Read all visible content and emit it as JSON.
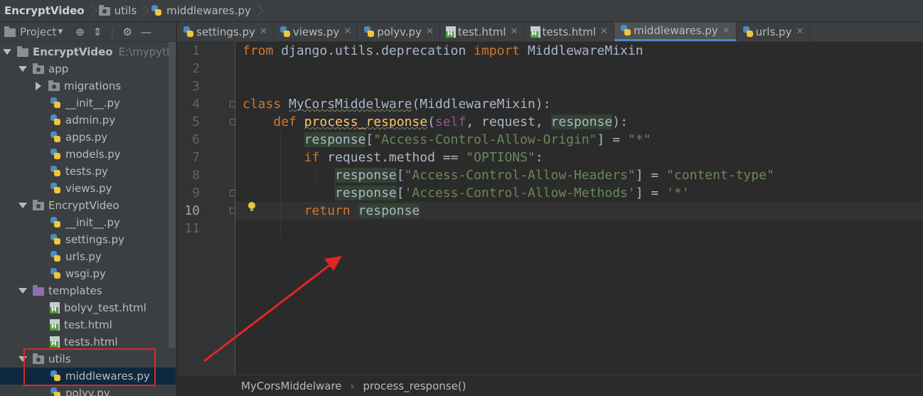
{
  "breadcrumb": [
    "EncryptVideo",
    "utils",
    "middlewares.py"
  ],
  "sidebar": {
    "view_label": "Project",
    "toolbar_icons": [
      "globe-icon",
      "collapse-icon",
      "gear-icon",
      "minimize-icon"
    ],
    "tree": [
      {
        "label": "EncryptVideo",
        "path": "E:\\mypython",
        "kind": "folder",
        "level": 0,
        "expanded": true
      },
      {
        "label": "app",
        "kind": "package",
        "level": 1,
        "expanded": true
      },
      {
        "label": "migrations",
        "kind": "package",
        "level": 2,
        "expanded": false
      },
      {
        "label": "__init__.py",
        "kind": "py",
        "level": 2
      },
      {
        "label": "admin.py",
        "kind": "py",
        "level": 2
      },
      {
        "label": "apps.py",
        "kind": "py",
        "level": 2
      },
      {
        "label": "models.py",
        "kind": "py",
        "level": 2
      },
      {
        "label": "tests.py",
        "kind": "py",
        "level": 2
      },
      {
        "label": "views.py",
        "kind": "py",
        "level": 2
      },
      {
        "label": "EncryptVideo",
        "kind": "package",
        "level": 1,
        "expanded": true
      },
      {
        "label": "__init__.py",
        "kind": "py",
        "level": 2
      },
      {
        "label": "settings.py",
        "kind": "py",
        "level": 2
      },
      {
        "label": "urls.py",
        "kind": "py",
        "level": 2
      },
      {
        "label": "wsgi.py",
        "kind": "py",
        "level": 2
      },
      {
        "label": "templates",
        "kind": "templates",
        "level": 1,
        "expanded": true
      },
      {
        "label": "bolyv_test.html",
        "kind": "html",
        "level": 2
      },
      {
        "label": "test.html",
        "kind": "html",
        "level": 2
      },
      {
        "label": "tests.html",
        "kind": "html",
        "level": 2
      },
      {
        "label": "utils",
        "kind": "package",
        "level": 1,
        "expanded": true
      },
      {
        "label": "middlewares.py",
        "kind": "py",
        "level": 2,
        "selected": true
      },
      {
        "label": "polyv.py",
        "kind": "py",
        "level": 2
      }
    ]
  },
  "tabs": [
    {
      "label": "settings.py",
      "kind": "py"
    },
    {
      "label": "views.py",
      "kind": "py"
    },
    {
      "label": "polyv.py",
      "kind": "py"
    },
    {
      "label": "test.html",
      "kind": "html"
    },
    {
      "label": "tests.html",
      "kind": "html"
    },
    {
      "label": "middlewares.py",
      "kind": "py",
      "active": true
    },
    {
      "label": "urls.py",
      "kind": "py"
    }
  ],
  "editor": {
    "line_numbers": [
      "1",
      "2",
      "3",
      "4",
      "5",
      "6",
      "7",
      "8",
      "9",
      "10",
      "11"
    ],
    "current_line": 10,
    "lines": [
      [
        {
          "t": "from",
          "c": "kw"
        },
        {
          "t": " django.utils.deprecation "
        },
        {
          "t": "import",
          "c": "kw"
        },
        {
          "t": " MiddlewareMixin"
        }
      ],
      [],
      [],
      [
        {
          "t": "class",
          "c": "kw"
        },
        {
          "t": " "
        },
        {
          "t": "MyCorsMiddelware",
          "c": "wavy"
        },
        {
          "t": "(MiddlewareMixin):"
        }
      ],
      [
        {
          "t": "    "
        },
        {
          "t": "def",
          "c": "kw"
        },
        {
          "t": " "
        },
        {
          "t": "process_response",
          "c": "fn wavy"
        },
        {
          "t": "("
        },
        {
          "t": "self",
          "c": "self"
        },
        {
          "t": ", request, "
        },
        {
          "t": "response",
          "c": "hl"
        },
        {
          "t": "):"
        }
      ],
      [
        {
          "t": "        "
        },
        {
          "t": "response",
          "c": "hl"
        },
        {
          "t": "["
        },
        {
          "t": "\"Access-Control-Allow-Origin\"",
          "c": "str"
        },
        {
          "t": "] = "
        },
        {
          "t": "\"*\"",
          "c": "str"
        }
      ],
      [
        {
          "t": "        "
        },
        {
          "t": "if",
          "c": "kw"
        },
        {
          "t": " request.method == "
        },
        {
          "t": "\"OPTIONS\"",
          "c": "str"
        },
        {
          "t": ":"
        }
      ],
      [
        {
          "t": "            "
        },
        {
          "t": "response",
          "c": "hl"
        },
        {
          "t": "["
        },
        {
          "t": "\"Access-Control-Allow-Headers\"",
          "c": "str"
        },
        {
          "t": "] = "
        },
        {
          "t": "\"content-type\"",
          "c": "str"
        }
      ],
      [
        {
          "t": "            "
        },
        {
          "t": "response",
          "c": "hl"
        },
        {
          "t": "["
        },
        {
          "t": "'Access-Control-Allow-Methods'",
          "c": "str"
        },
        {
          "t": "] = "
        },
        {
          "t": "'*'",
          "c": "str"
        }
      ],
      [
        {
          "t": "        "
        },
        {
          "t": "return",
          "c": "kw"
        },
        {
          "t": " "
        },
        {
          "t": "response",
          "c": "hl"
        }
      ],
      []
    ]
  },
  "footer_breadcrumb": [
    "MyCorsMiddelware",
    "process_response()"
  ],
  "colors": {
    "annotation_red": "#e12626",
    "keyword": "#cc7832",
    "string": "#6a8759",
    "function": "#ffc66d",
    "self": "#94558d",
    "selection": "#0d293e"
  }
}
